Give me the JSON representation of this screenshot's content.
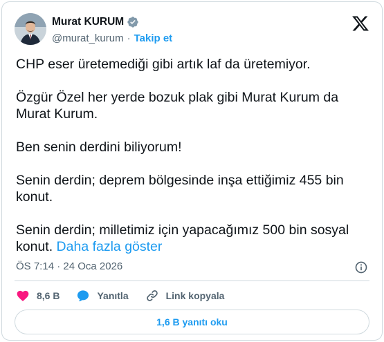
{
  "author": {
    "display_name": "Murat KURUM",
    "handle": "@murat_kurum",
    "separator": "·",
    "follow_label": "Takip et"
  },
  "tweet": {
    "paragraphs": [
      "CHP eser üretemediği gibi artık laf da üretemiyor.",
      "Özgür Özel her yerde bozuk plak gibi Murat Kurum da Murat Kurum.",
      "Ben senin derdini biliyorum!",
      "Senin derdin; deprem bölgesinde inşa ettiğimiz 455 bin konut.",
      "Senin derdin; milletimiz için yapacağımız 500 bin sosyal konut."
    ],
    "show_more": "Daha fazla göster",
    "timestamp": "ÖS 7:14 · 24 Oca 2026"
  },
  "actions": {
    "likes": "8,6 B",
    "reply_label": "Yanıtla",
    "copy_link_label": "Link kopyala"
  },
  "read_replies_label": "1,6 B yanıtı oku",
  "colors": {
    "accent": "#1d9bf0",
    "like": "#f91880",
    "text": "#0f1419",
    "muted": "#536471",
    "border": "#cfd9de"
  }
}
